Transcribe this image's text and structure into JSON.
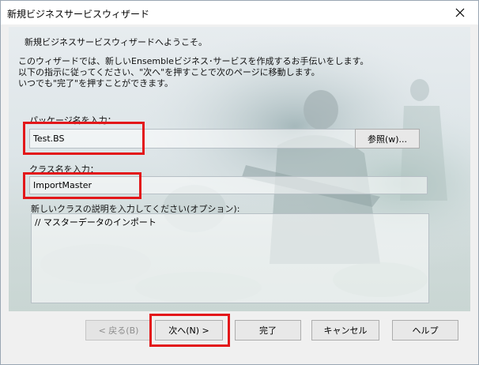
{
  "window": {
    "title": "新規ビジネスサービスウィザード",
    "close_icon": "close-icon"
  },
  "intro": {
    "heading": "新規ビジネスサービスウィザードへようこそ。",
    "line1": "このウィザードでは、新しいEnsembleビジネス･サービスを作成するお手伝いをします。",
    "line2": "以下の指示に従ってください、\"次へ\"を押すことで次のページに移動します。",
    "line3": "いつでも\"完了\"を押すことができます。"
  },
  "package": {
    "label": "パッケージ名を入力：",
    "value": "Test.BS",
    "browse_label": "参照(w)..."
  },
  "class": {
    "label": "クラス名を入力：",
    "value": "ImportMaster"
  },
  "description": {
    "label": "新しいクラスの説明を入力してください(オプション):",
    "value": "// マスターデータのインポート"
  },
  "buttons": {
    "back": "< 戻る(B)",
    "next": "次へ(N) >",
    "finish": "完了",
    "cancel": "キャンセル",
    "help": "ヘルプ"
  },
  "colors": {
    "highlight": "#e3171a"
  }
}
